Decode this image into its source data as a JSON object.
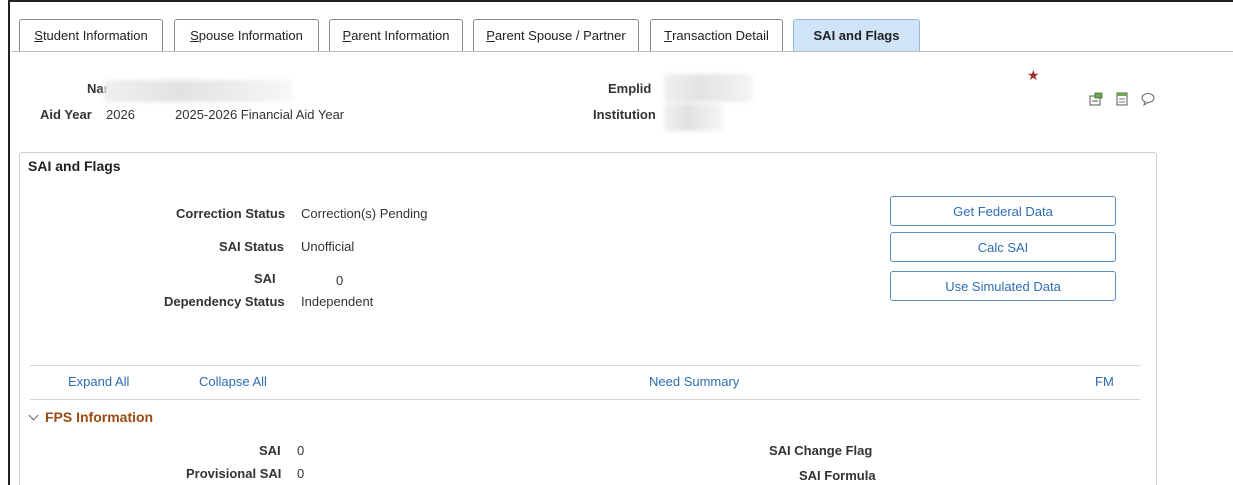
{
  "tabs": [
    {
      "pre": "",
      "u": "S",
      "post": "tudent Information"
    },
    {
      "pre": "",
      "u": "S",
      "post": "pouse Information"
    },
    {
      "pre": "",
      "u": "P",
      "post": "arent Information"
    },
    {
      "pre": "",
      "u": "P",
      "post": "arent Spouse / Partner"
    },
    {
      "pre": "",
      "u": "T",
      "post": "ransaction Detail"
    },
    {
      "pre": "",
      "u": "",
      "post": "SAI and Flags"
    }
  ],
  "header": {
    "name_label": "Name",
    "aid_year_label": "Aid Year",
    "aid_year": "2026",
    "aid_year_desc": "2025-2026 Financial Aid Year",
    "emplid_label": "Emplid",
    "institution_label": "Institution"
  },
  "section": {
    "title": "SAI and Flags",
    "fields": {
      "correction_status_label": "Correction Status",
      "correction_status": "Correction(s) Pending",
      "sai_status_label": "SAI Status",
      "sai_status": "Unofficial",
      "sai_label": "SAI",
      "sai": "0",
      "dependency_label": "Dependency Status",
      "dependency": "Independent"
    },
    "buttons": {
      "get_federal": "Get Federal Data",
      "calc_sai": "Calc SAI",
      "use_simulated": "Use Simulated Data"
    },
    "links": {
      "expand_all": "Expand All",
      "collapse_all": "Collapse All",
      "need_summary": "Need Summary",
      "fm": "FM"
    }
  },
  "fps": {
    "title": "FPS Information",
    "sai_label": "SAI",
    "sai": "0",
    "provisional_label": "Provisional SAI",
    "provisional": "0",
    "change_flag_label": "SAI Change Flag",
    "formula_label": "SAI Formula"
  },
  "colors": {
    "accent": "#2d6db5",
    "active_tab": "#cfe4f7",
    "section_heading": "#9a4a12",
    "required_star": "#a0302a"
  },
  "icons": [
    "related-info-icon",
    "notepad-icon",
    "comment-icon"
  ]
}
